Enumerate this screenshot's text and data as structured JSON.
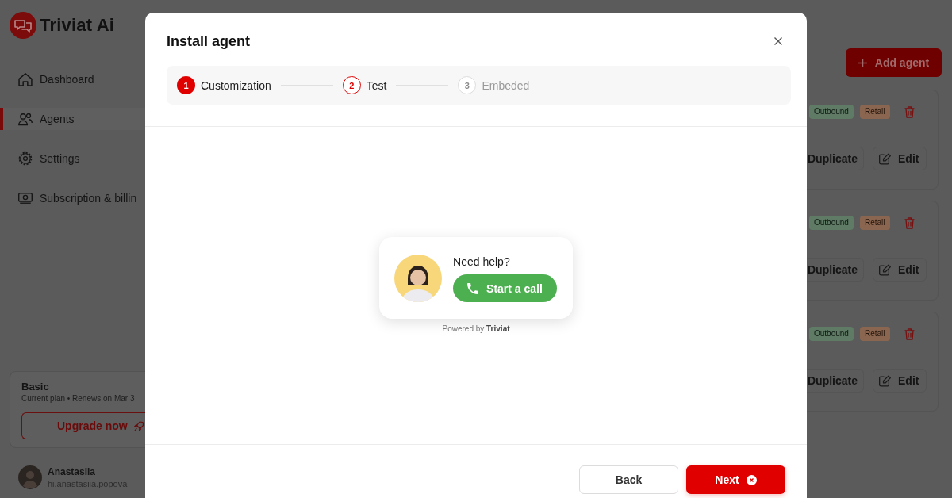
{
  "sidebar": {
    "brand": "Triviat Ai",
    "nav": [
      {
        "label": "Dashboard",
        "selected": false
      },
      {
        "label": "Agents",
        "selected": true
      },
      {
        "label": "Settings",
        "selected": false
      },
      {
        "label": "Subscription & billin",
        "selected": false
      }
    ],
    "plan": {
      "name": "Basic",
      "details": "Current plan • Renews on Mar 3",
      "upgrade_button": "Upgrade now"
    },
    "user": {
      "name": "Anastasiia",
      "email": "hi.anastasiia.popova"
    }
  },
  "main": {
    "add_button": "Add agent",
    "agents": [
      {
        "tags": [
          {
            "label": "Outbound",
            "color": "#5f7a65"
          },
          {
            "label": "Retail",
            "color": "#8a6650"
          }
        ],
        "actions": [
          {
            "label": "Duplicate",
            "kind": "plain"
          },
          {
            "label": "Edit",
            "kind": "edit"
          }
        ]
      },
      {
        "tags": [
          {
            "label": "Outbound",
            "color": "#5f7a65"
          },
          {
            "label": "Retail",
            "color": "#8a6650"
          }
        ],
        "actions": [
          {
            "label": "Duplicate",
            "kind": "plain"
          },
          {
            "label": "Edit",
            "kind": "edit"
          }
        ]
      },
      {
        "tags": [
          {
            "label": "Outbound",
            "color": "#5f7a65"
          },
          {
            "label": "Retail",
            "color": "#8a6650"
          }
        ],
        "actions": [
          {
            "label": "Duplicate",
            "kind": "plain"
          },
          {
            "label": "Edit",
            "kind": "edit"
          }
        ]
      }
    ]
  },
  "modal": {
    "title": "Install agent",
    "steps": [
      {
        "number": "1",
        "label": "Customization",
        "completed": true,
        "selected": false
      },
      {
        "number": "2",
        "label": "Test",
        "completed": false,
        "selected": true
      },
      {
        "number": "3",
        "label": "Embeded",
        "completed": false,
        "selected": false
      }
    ],
    "widget": {
      "prompt": "Need help?",
      "call_button": "Start a call",
      "powered_by": "Powered by **Triviat**"
    },
    "buttons": [
      {
        "label": "Back",
        "kind": "secondary"
      },
      {
        "label": "Next",
        "kind": "primary"
      }
    ]
  }
}
